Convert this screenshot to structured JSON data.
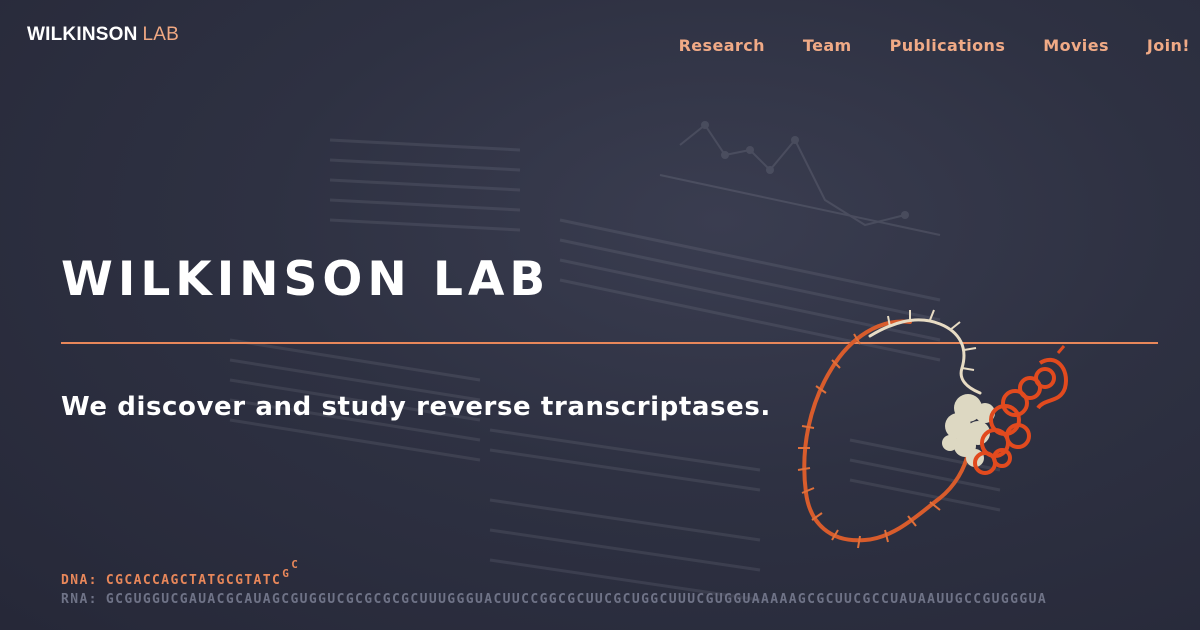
{
  "brand": {
    "logo_strong": "WILKINSON",
    "logo_light": "LAB",
    "accent_color": "#e8875a",
    "nav_color": "#f0aa86",
    "background_color": "#2c2f40"
  },
  "nav": {
    "items": [
      {
        "label": "Research"
      },
      {
        "label": "Team"
      },
      {
        "label": "Publications"
      },
      {
        "label": "Movies"
      },
      {
        "label": "Join!"
      }
    ]
  },
  "hero": {
    "title": "WILKINSON LAB",
    "tagline": "We discover and study reverse transcriptases."
  },
  "sequences": {
    "dna_label": "DNA:",
    "dna_sequence": "CGCACCAGCTATGCGTATC",
    "dna_extra_1": "G",
    "dna_extra_2": "C",
    "rna_label": "RNA:",
    "rna_sequence": "GCGUGGUCGAUACGCAUAGCGUGGUCGCGCGCGCUUUGGGUACUUCCGGCGCUUCGCUGGCUUUCGUGGUAAAAAGCGCUUCGCCUAUAAUUGCCGUGGGUA"
  },
  "icons": {
    "molecule": "rna-polymerase-molecule-illustration"
  }
}
